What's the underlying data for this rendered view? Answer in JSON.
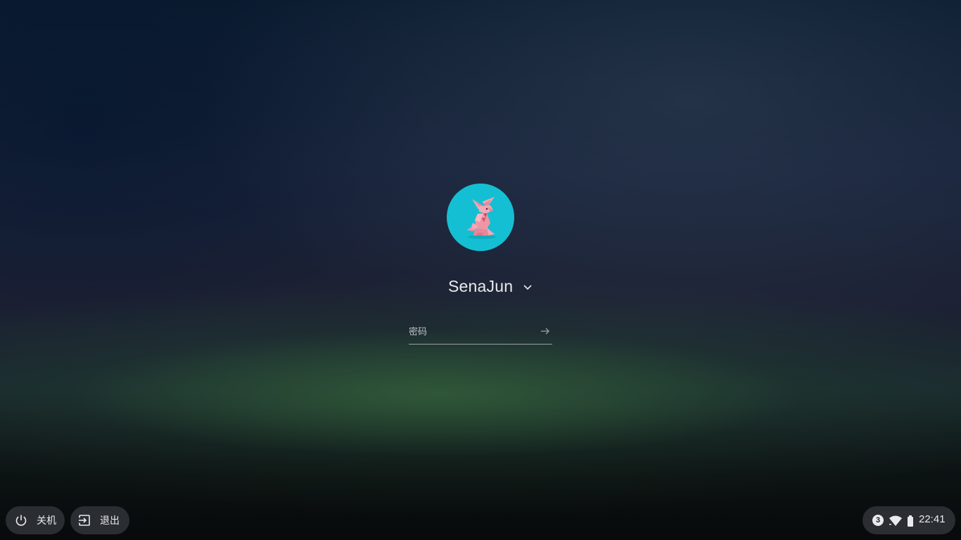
{
  "user": {
    "name": "SenaJun",
    "avatar_icon": "origami-rabbit-avatar",
    "avatar_bg": "#15bfd3"
  },
  "password": {
    "placeholder": "密码",
    "submit_icon": "arrow-right-icon"
  },
  "shelf": {
    "power_label": "关机",
    "power_icon": "power-icon",
    "signout_label": "退出",
    "signout_icon": "exit-icon"
  },
  "status": {
    "notification_count": "3",
    "wifi_icon": "wifi-icon",
    "battery_icon": "battery-icon",
    "time": "22:41"
  },
  "colors": {
    "text": "#e8eaed",
    "pill_bg": "#30343a"
  }
}
